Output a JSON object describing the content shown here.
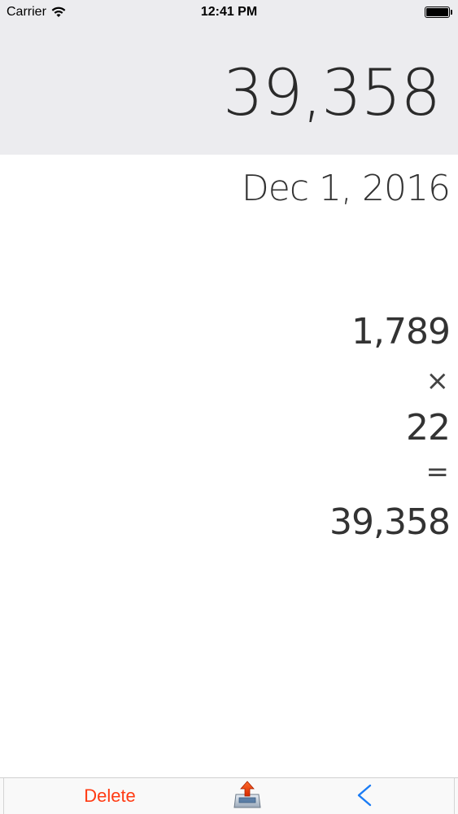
{
  "status_bar": {
    "carrier": "Carrier",
    "time": "12:41 PM",
    "wifi_icon": "wifi-icon",
    "battery_icon": "battery-icon"
  },
  "display": {
    "value": "39,358"
  },
  "history": {
    "date": "Dec 1, 2016",
    "operand1": "1,789",
    "operator": "×",
    "operand2": "22",
    "equals": "=",
    "result": "39,358"
  },
  "toolbar": {
    "delete_label": "Delete",
    "share_icon": "share-tray-icon",
    "back_icon": "chevron-left-icon",
    "delete_color": "#ff3b13",
    "back_color": "#1a7cf5"
  }
}
